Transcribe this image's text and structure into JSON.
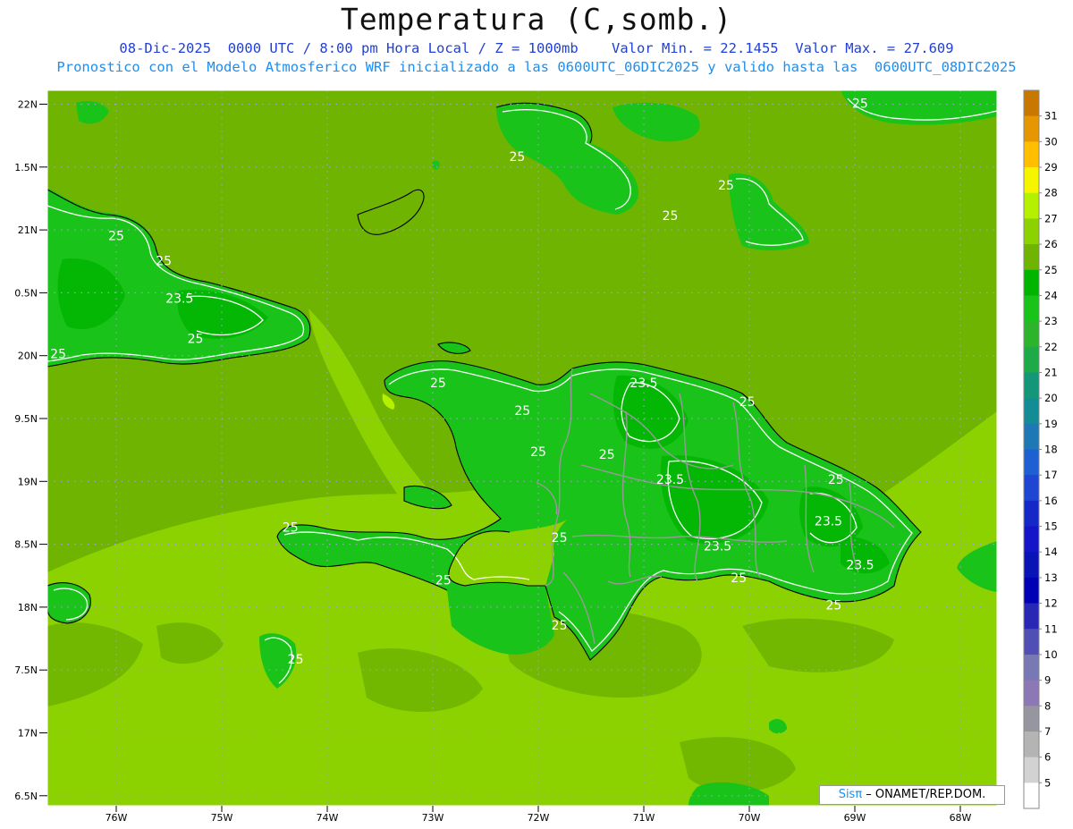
{
  "title": "Temperatura (C,somb.)",
  "subtitle_line1": "08-Dic-2025  0000 UTC / 8:00 pm Hora Local / Z = 1000mb    Valor Min. = 22.1455  Valor Max. = 27.609",
  "subtitle_line2": "Pronostico con el Modelo Atmosferico WRF inicializado a las 0600UTC_06DIC2025 y valido hasta las  0600UTC_08DIC2025",
  "logo": {
    "sis": "Sisπ",
    "text": " – ONAMET/REP.DOM."
  },
  "map": {
    "lat_labels": [
      "22N",
      "1.5N",
      "21N",
      "0.5N",
      "20N",
      "9.5N",
      "19N",
      "8.5N",
      "18N",
      "7.5N",
      "17N",
      "6.5N"
    ],
    "lon_labels": [
      "76W",
      "75W",
      "74W",
      "73W",
      "72W",
      "71W",
      "70W",
      "69W",
      "68W"
    ],
    "contour_labels": [
      {
        "text": "25",
        "lon": -76.0,
        "lat": 20.92
      },
      {
        "text": "25",
        "lon": -75.55,
        "lat": 20.72
      },
      {
        "text": "23.5",
        "lon": -75.4,
        "lat": 20.42
      },
      {
        "text": "25",
        "lon": -75.25,
        "lat": 20.1
      },
      {
        "text": "25",
        "lon": -76.55,
        "lat": 19.98
      },
      {
        "text": "25",
        "lon": -72.95,
        "lat": 19.75
      },
      {
        "text": "25",
        "lon": -72.15,
        "lat": 19.53
      },
      {
        "text": "25",
        "lon": -72.0,
        "lat": 19.2
      },
      {
        "text": "23.5",
        "lon": -71.0,
        "lat": 19.75
      },
      {
        "text": "25",
        "lon": -70.02,
        "lat": 19.6
      },
      {
        "text": "25",
        "lon": -71.35,
        "lat": 19.18
      },
      {
        "text": "23.5",
        "lon": -70.75,
        "lat": 18.98
      },
      {
        "text": "25",
        "lon": -69.18,
        "lat": 18.98
      },
      {
        "text": "23.5",
        "lon": -69.25,
        "lat": 18.65
      },
      {
        "text": "25",
        "lon": -71.8,
        "lat": 18.52
      },
      {
        "text": "23.5",
        "lon": -70.3,
        "lat": 18.45
      },
      {
        "text": "23.5",
        "lon": -68.95,
        "lat": 18.3
      },
      {
        "text": "25",
        "lon": -70.1,
        "lat": 18.2
      },
      {
        "text": "25",
        "lon": -69.2,
        "lat": 17.98
      },
      {
        "text": "25",
        "lon": -72.9,
        "lat": 18.18
      },
      {
        "text": "25",
        "lon": -74.35,
        "lat": 18.6
      },
      {
        "text": "25",
        "lon": -74.3,
        "lat": 17.55
      },
      {
        "text": "25",
        "lon": -71.8,
        "lat": 17.82
      },
      {
        "text": "25",
        "lon": -72.2,
        "lat": 21.55
      },
      {
        "text": "25",
        "lon": -70.22,
        "lat": 21.32
      },
      {
        "text": "25",
        "lon": -70.75,
        "lat": 21.08
      },
      {
        "text": "25",
        "lon": -68.95,
        "lat": 21.97
      }
    ]
  },
  "colorbar": {
    "labels": [
      "31",
      "30",
      "29",
      "28",
      "27",
      "26",
      "25",
      "24",
      "23",
      "22",
      "21",
      "20",
      "19",
      "18",
      "17",
      "16",
      "15",
      "14",
      "13",
      "12",
      "11",
      "10",
      "9",
      "8",
      "7",
      "6",
      "5"
    ],
    "colors": [
      "#c87800",
      "#e69600",
      "#ffbe00",
      "#f5f500",
      "#b4f000",
      "#8cd200",
      "#6eb400",
      "#00b400",
      "#19c319",
      "#2db42d",
      "#1eaa46",
      "#149678",
      "#148c96",
      "#1e78b4",
      "#1e5fd2",
      "#1e46d2",
      "#1428c8",
      "#1414c8",
      "#0a14b4",
      "#0000b4",
      "#2828b4",
      "#5050b4",
      "#7878b4",
      "#8c78b4",
      "#9696a0",
      "#b4b4b4",
      "#d2d2d2",
      "#ffffff"
    ]
  },
  "colors": {
    "sea_main": "#6eb400",
    "sea_warm": "#8cd200",
    "sea_hot": "#b4f000",
    "land": "#19c319",
    "land_cool": "#00b400",
    "coast": "#000000",
    "border": "#999999",
    "contour": "#ffffff",
    "grid": "#a0a0c8"
  }
}
